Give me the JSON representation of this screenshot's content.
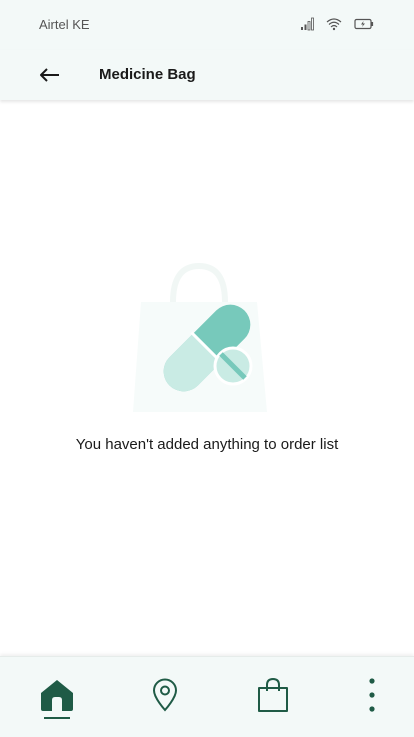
{
  "status_bar": {
    "carrier": "Airtel KE",
    "icons": [
      "signal-icon",
      "wifi-icon",
      "battery-icon"
    ]
  },
  "app_bar": {
    "back_icon": "arrow-left-icon",
    "title": "Medicine Bag"
  },
  "empty_state": {
    "illustration": "pill-bag-icon",
    "message": "You haven't added anything to order list"
  },
  "bottom_nav": {
    "items": [
      {
        "icon": "home-icon",
        "active": true
      },
      {
        "icon": "location-pin-icon",
        "active": false
      },
      {
        "icon": "shopping-bag-icon",
        "active": false
      },
      {
        "icon": "more-vertical-icon",
        "active": false
      }
    ]
  },
  "colors": {
    "accent": "#1f5b46",
    "pill_dark": "#77c9bb",
    "pill_light": "#c9ebe4",
    "surface": "#f3f9f8"
  }
}
